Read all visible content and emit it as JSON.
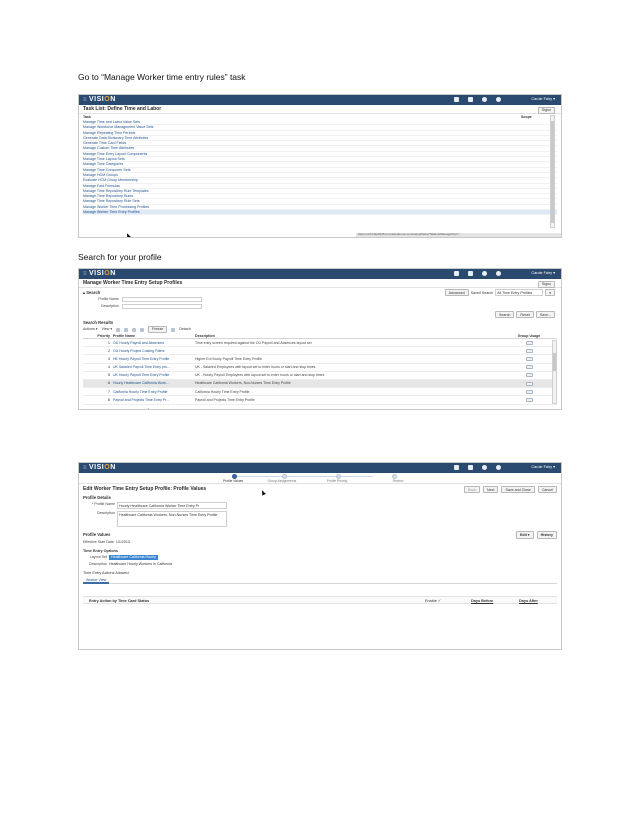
{
  "captions": {
    "step1": "Go to “Manage Worker time entry rules” task",
    "step2": "Search for your profile"
  },
  "app": {
    "logo_prefix": "≡",
    "logo_text_a": "VISI",
    "logo_text_o": "O",
    "logo_text_b": "N",
    "user": "Carole Fairy ▾"
  },
  "screen1": {
    "title": "Task List: Define Time and Labor",
    "action_button": "Signo",
    "col_task": "Task",
    "col_scope": "Scope",
    "tasks": [
      "Manage Time and Labor Value Sets",
      "Manage Workforce Management Value Sets",
      "Manage Repeating Time Periods",
      "Generate Data Dictionary Time Attributes",
      "Generate Time Card Fields",
      "Manage Custom Time Attributes",
      "Manage Time Entry Layout Components",
      "Manage Time Layout Sets",
      "Manage Time Categories",
      "Manage Time Consumer Sets",
      "Manage HCM Groups",
      "Evaluate HCM Group Membership",
      "Manage Fast Formulas",
      "Manage Time Repository Rule Templates",
      "Manage Time Repository Rules",
      "Manage Time Repository Rule Sets",
      "Manage Worker Time Processing Profiles",
      "Manage Worker Time Entry Profiles"
    ],
    "status_url": "https://ucf4-fap0445-fs.oracledemos.com/setup/faces/TaskListManagerTop?..."
  },
  "screen2": {
    "title": "Manage Worker Time Entry Setup Profiles",
    "action_button": "Signo",
    "search_label": "▴ Search",
    "advanced": "Advanced",
    "saved_search_label": "Saved Search",
    "saved_search_value": "All Time Entry Profiles",
    "field_profile_name": "Profile Name",
    "field_description": "Description",
    "btn_search": "Search",
    "btn_reset": "Reset",
    "btn_save": "Save...",
    "results_label": "Search Results",
    "actions_menu": "Actions ▾",
    "view_menu": "View ▾",
    "freeze": "Freeze",
    "detach": "Detach",
    "col_priority": "Priority",
    "col_profile_name": "Profile Name",
    "col_description": "Description",
    "col_group_usage": "Group Usage",
    "rows": [
      {
        "priority": "1",
        "name": "OU Hourly Payroll and Absences",
        "desc": "Time entry screen required against the OU Payroll and Absences layout set"
      },
      {
        "priority": "2",
        "name": "OU Hourly Project Costing Filters",
        "desc": ""
      },
      {
        "priority": "3",
        "name": "HE Hourly Payroll Time Entry Profile",
        "desc": "Higher Ed Hourly Payroll Time Entry Profile"
      },
      {
        "priority": "4",
        "name": "UK Salaried Payroll Time Entry pro...",
        "desc": "UK - Salaried Employees with layout set to enter hours or start and stop times"
      },
      {
        "priority": "5",
        "name": "UK Hourly Payroll Time Entry Profile",
        "desc": "UK - Hourly Payroll Employees with layout set to enter hours or start and stop times"
      },
      {
        "priority": "6",
        "name": "Hourly Healthcare California Work...",
        "desc": "Healthcare California Workers, Non-Nurses Time Entry Profile"
      },
      {
        "priority": "7",
        "name": "California Hourly Time Entry Profile",
        "desc": "California Hourly Time Entry Profile"
      },
      {
        "priority": "8",
        "name": "Payroll and Projects Time Entry Pr...",
        "desc": "Payroll and Projects Time Entry Profile"
      }
    ],
    "selected_row": 5
  },
  "screen3": {
    "train": [
      "Profile Values",
      "Group Assignments",
      "Profile Priority",
      "Review"
    ],
    "title": "Edit Worker Time Entry Setup Profile: Profile Values",
    "btn_back": "Back",
    "btn_next": "Next",
    "btn_save_close": "Save and Close",
    "btn_cancel": "Cancel",
    "profile_details": "Profile Details",
    "label_profile_name": "* Profile Name",
    "value_profile_name": "Hourly Healthcare California Worker Time Entry Pr",
    "label_description": "Description",
    "value_description": "Healthcare California Workers, Non-Nurses Time Entry Profile",
    "profile_values": "Profile Values",
    "edit_menu": "Edit ▾",
    "history": "History",
    "effective_label": "Effective Start Date",
    "effective_value": "1/1/2013",
    "time_entry_options": "Time Entry Options",
    "layout_set_label": "Layout Set",
    "layout_set_value": "Healthcare California Hourly",
    "layout_desc_label": "Description",
    "layout_desc_value": "Healthcare Hourly Workers in California",
    "actions_allowed": "Time Entry Actions Allowed",
    "tab_worker": "Worker View",
    "grid_col1": "Entry Action by Time Card Status",
    "grid_col2": "Enable ✓",
    "grid_col3": "Days Before",
    "grid_col4": "Days After"
  }
}
